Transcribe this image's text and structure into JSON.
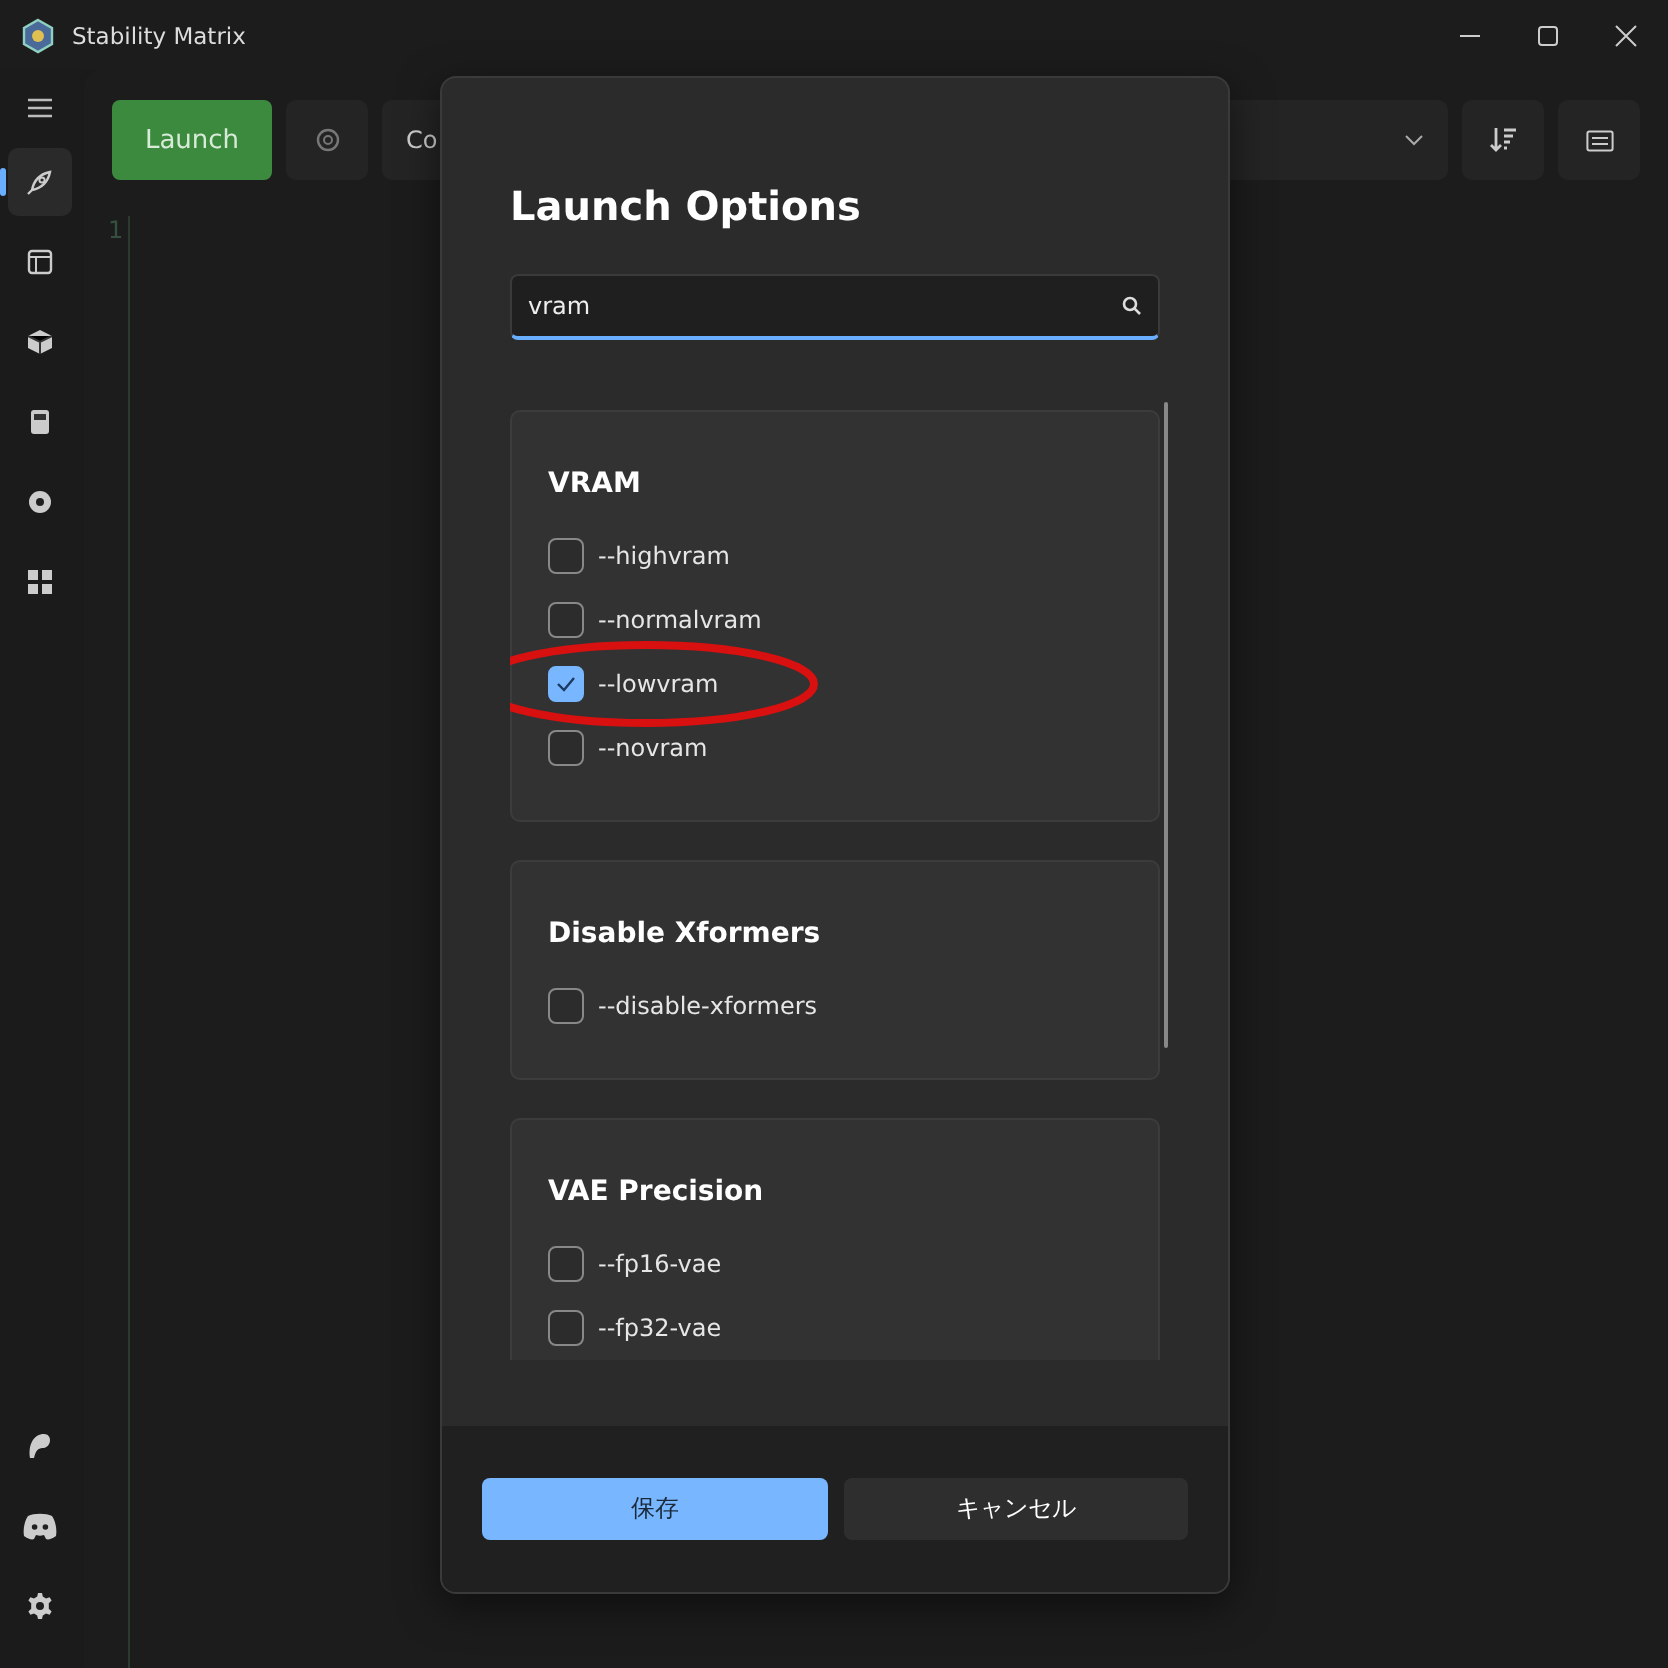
{
  "window": {
    "title": "Stability Matrix"
  },
  "sidebar": {
    "items": [
      {
        "kind": "rocket",
        "selected": true
      },
      {
        "kind": "browser",
        "selected": false
      },
      {
        "kind": "box",
        "selected": false
      },
      {
        "kind": "calc",
        "selected": false
      },
      {
        "kind": "gear",
        "selected": false
      },
      {
        "kind": "grid",
        "selected": false
      }
    ],
    "bottom": [
      {
        "kind": "patreon"
      },
      {
        "kind": "discord"
      },
      {
        "kind": "settings"
      }
    ]
  },
  "toolbar": {
    "launch": "Launch",
    "combo": "Co"
  },
  "editor": {
    "line_numbers": [
      "1"
    ]
  },
  "dialog": {
    "title": "Launch Options",
    "search": {
      "value": "vram"
    },
    "sections": [
      {
        "title": "VRAM",
        "options": [
          {
            "label": "--highvram",
            "checked": false,
            "circled": false
          },
          {
            "label": "--normalvram",
            "checked": false,
            "circled": false
          },
          {
            "label": "--lowvram",
            "checked": true,
            "circled": true
          },
          {
            "label": "--novram",
            "checked": false,
            "circled": false
          }
        ]
      },
      {
        "title": "Disable Xformers",
        "options": [
          {
            "label": "--disable-xformers",
            "checked": false,
            "circled": false
          }
        ]
      },
      {
        "title": "VAE Precision",
        "options": [
          {
            "label": "--fp16-vae",
            "checked": false,
            "circled": false
          },
          {
            "label": "--fp32-vae",
            "checked": false,
            "circled": false
          }
        ]
      }
    ],
    "buttons": {
      "save": "保存",
      "cancel": "キャンセル"
    }
  }
}
